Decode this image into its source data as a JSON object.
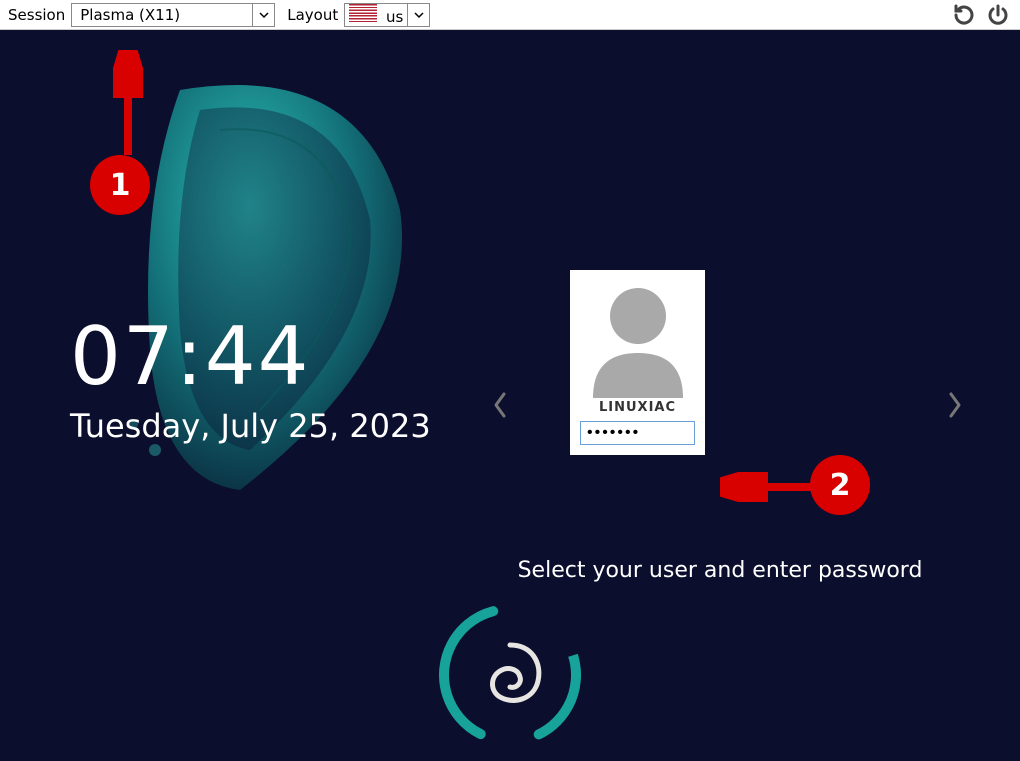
{
  "topbar": {
    "session_label": "Session",
    "session_value": "Plasma (X11)",
    "layout_label": "Layout",
    "layout_value": "us"
  },
  "clock": {
    "time": "07:44",
    "date": "Tuesday, July 25, 2023"
  },
  "login": {
    "username": "LINUXIAC",
    "password_mask": "•••••••",
    "hint": "Select your user and enter password"
  },
  "annotations": {
    "badge1": "1",
    "badge2": "2"
  }
}
